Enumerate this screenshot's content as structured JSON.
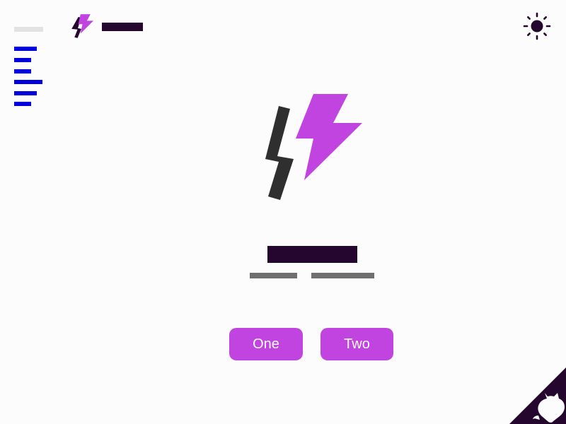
{
  "header": {
    "logo_icon": "lightning-bolt-logo",
    "theme_toggle_icon": "sun-icon"
  },
  "hero": {
    "logo_icon": "lightning-bolt-logo"
  },
  "actions": {
    "button_one_label": "One",
    "button_two_label": "Two"
  },
  "corner": {
    "icon": "github-octocat-icon"
  },
  "colors": {
    "accent": "#c244e0",
    "dark": "#24062e",
    "logo_dark": "#2f2f2f",
    "nav_blue": "#0000dd",
    "muted": "#6f6f6f",
    "background": "#fcfcfc"
  }
}
